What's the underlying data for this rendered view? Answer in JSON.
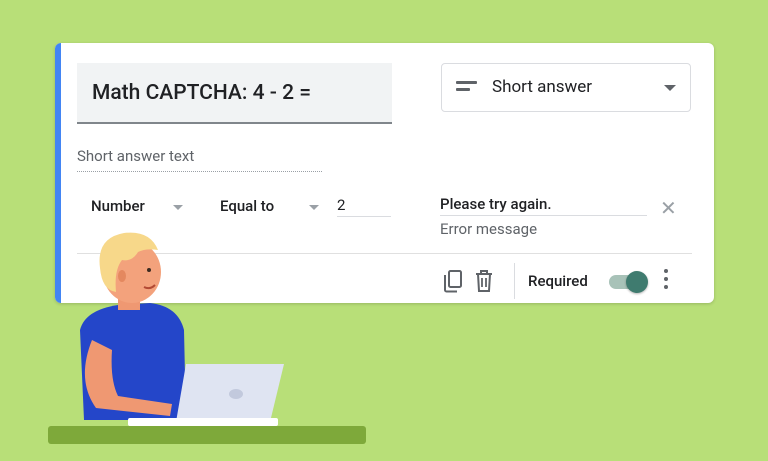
{
  "question": {
    "title": "Math CAPTCHA: 4 - 2 ="
  },
  "question_type": {
    "selected": "Short answer"
  },
  "answer": {
    "placeholder": "Short answer text"
  },
  "validation": {
    "type": "Number",
    "condition": "Equal to",
    "value": "2",
    "error_text": "Please try again.",
    "error_caption": "Error message"
  },
  "footer": {
    "required_label": "Required",
    "required_on": true
  },
  "colors": {
    "background": "#b8df78",
    "accent": "#4285f4",
    "toggle": "#3f7b6f"
  }
}
